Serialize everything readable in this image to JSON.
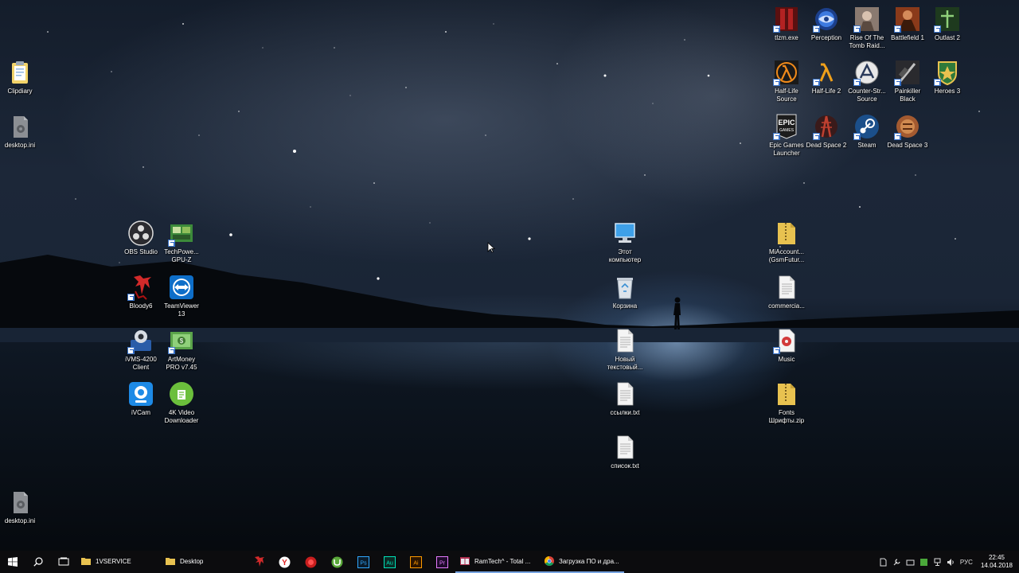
{
  "desktop": {
    "left_column": [
      {
        "label": "Clipdiary",
        "icon": "clipboard-icon"
      },
      {
        "label": "desktop.ini",
        "icon": "settings-file-icon"
      }
    ],
    "bottom_left": {
      "label": "desktop.ini",
      "icon": "settings-file-icon"
    },
    "apps_grid": [
      {
        "label": "OBS Studio",
        "icon": "obs-icon"
      },
      {
        "label": "TechPowe...\nGPU-Z",
        "icon": "gpuz-icon"
      },
      {
        "label": "Bloody6",
        "icon": "bloody-icon"
      },
      {
        "label": "TeamViewer\n13",
        "icon": "teamviewer-icon"
      },
      {
        "label": "iVMS-4200\nClient",
        "icon": "ivms-icon"
      },
      {
        "label": "ArtMoney\nPRO v7.45",
        "icon": "artmoney-icon"
      },
      {
        "label": "iVCam",
        "icon": "ivcam-icon"
      },
      {
        "label": "4K Video\nDownloader",
        "icon": "4k-video-icon"
      }
    ],
    "center_column": [
      {
        "label": "Этот\nкомпьютер",
        "icon": "computer-icon"
      },
      {
        "label": "Корзина",
        "icon": "recycle-bin-icon"
      },
      {
        "label": "Новый\nтекстовый...",
        "icon": "text-file-icon"
      },
      {
        "label": "ссылки.txt",
        "icon": "text-file-icon"
      },
      {
        "label": "список.txt",
        "icon": "text-file-icon"
      }
    ],
    "right_column": [
      {
        "label": "MiAccount...\n(GsmFutur...",
        "icon": "zip-folder-icon"
      },
      {
        "label": "commercia...",
        "icon": "text-file-icon"
      },
      {
        "label": "Music",
        "icon": "music-icon"
      },
      {
        "label": "Fonts\nШрифты.zip",
        "icon": "zip-folder-icon"
      }
    ],
    "games_row1": [
      {
        "label": "tlzm.exe",
        "icon": "game-exe-icon"
      },
      {
        "label": "Perception",
        "icon": "perception-icon"
      },
      {
        "label": "Rise Of The\nTomb Raid...",
        "icon": "tomb-raider-icon"
      },
      {
        "label": "Battlefield 1",
        "icon": "battlefield-icon"
      },
      {
        "label": "Outlast 2",
        "icon": "outlast-icon"
      }
    ],
    "games_row2": [
      {
        "label": "Half-Life\nSource",
        "icon": "half-life-icon"
      },
      {
        "label": "Half-Life 2",
        "icon": "half-life-2-icon"
      },
      {
        "label": "Counter-Str...\nSource",
        "icon": "counter-strike-icon"
      },
      {
        "label": "Painkiller\nBlack",
        "icon": "painkiller-icon"
      },
      {
        "label": "Heroes 3",
        "icon": "heroes-icon"
      }
    ],
    "games_row3": [
      {
        "label": "Epic Games\nLauncher",
        "icon": "epic-games-icon"
      },
      {
        "label": "Dead Space 2",
        "icon": "dead-space-2-icon"
      },
      {
        "label": "Steam",
        "icon": "steam-icon"
      },
      {
        "label": "Dead Space 3",
        "icon": "dead-space-3-icon"
      }
    ]
  },
  "taskbar": {
    "tasks": [
      {
        "label": "1VSERVICE",
        "icon": "folder-icon"
      },
      {
        "label": "Desktop",
        "icon": "folder-icon"
      }
    ],
    "pinned": [
      "bloody-app-icon",
      "yandex-browser-icon",
      "record-icon",
      "utorrent-icon",
      "photoshop-icon",
      "audition-icon",
      "illustrator-icon",
      "premiere-icon"
    ],
    "pinned_text": {
      "ps": "Ps",
      "au": "Au",
      "ai": "Ai",
      "pr": "Pr",
      "y": "Y"
    },
    "windows": [
      {
        "label": "RamTech^ - Total ...",
        "icon": "total-commander-icon"
      },
      {
        "label": "Загрузка ПО и дра...",
        "icon": "chrome-icon"
      }
    ],
    "language": "РУС",
    "time": "22:45",
    "date": "14.04.2018"
  },
  "colors": {
    "taskbar": "#0c0c0e",
    "accent": "#76a3e0",
    "folder": "#e8c250"
  }
}
